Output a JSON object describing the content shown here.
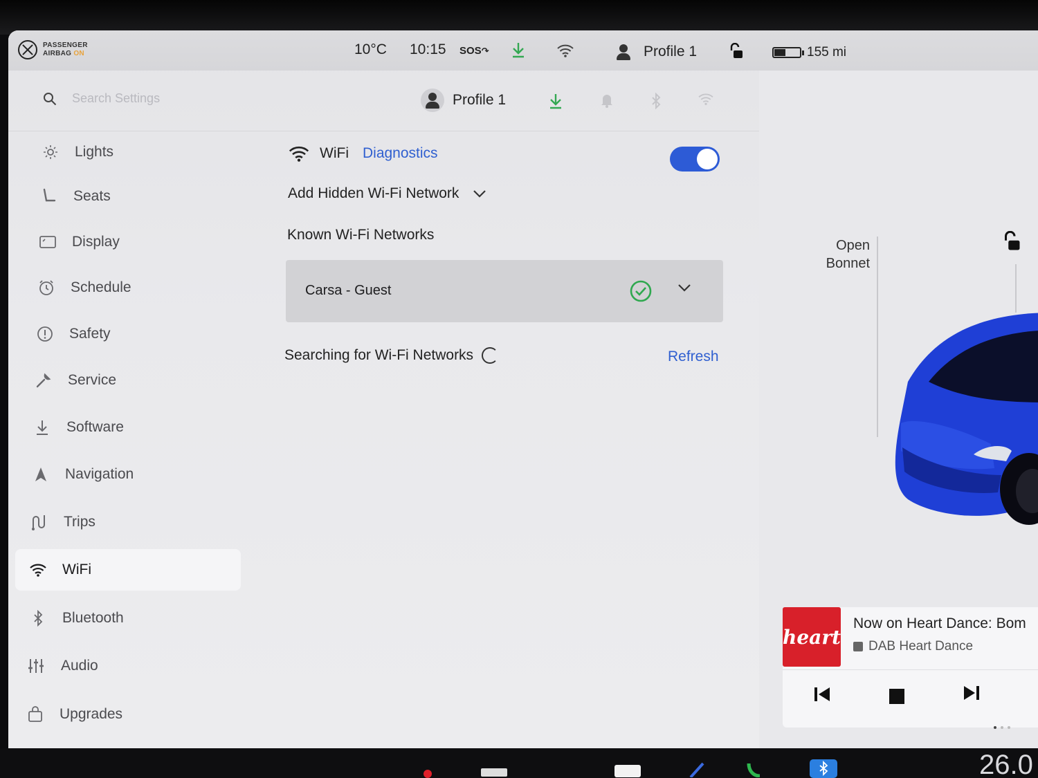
{
  "status_bar": {
    "airbag_line1": "PASSENGER",
    "airbag_line2": "AIRBAG",
    "airbag_state": "ON",
    "temperature": "10°C",
    "time": "10:15",
    "sos": "SOS",
    "profile": "Profile 1",
    "range": "155 mi",
    "battery_level": 0.45
  },
  "header": {
    "search_placeholder": "Search Settings",
    "profile": "Profile 1"
  },
  "sidebar": {
    "items": [
      {
        "label": "Lights",
        "icon": "sun-icon"
      },
      {
        "label": "Seats",
        "icon": "seat-icon"
      },
      {
        "label": "Display",
        "icon": "display-icon"
      },
      {
        "label": "Schedule",
        "icon": "alarm-clock-icon"
      },
      {
        "label": "Safety",
        "icon": "alert-circle-icon"
      },
      {
        "label": "Service",
        "icon": "wrench-icon"
      },
      {
        "label": "Software",
        "icon": "download-icon"
      },
      {
        "label": "Navigation",
        "icon": "navigation-arrow-icon"
      },
      {
        "label": "Trips",
        "icon": "trips-icon"
      },
      {
        "label": "WiFi",
        "icon": "wifi-icon"
      },
      {
        "label": "Bluetooth",
        "icon": "bluetooth-icon"
      },
      {
        "label": "Audio",
        "icon": "sliders-icon"
      },
      {
        "label": "Upgrades",
        "icon": "bag-icon"
      }
    ],
    "active": "WiFi"
  },
  "wifi": {
    "title": "WiFi",
    "diagnostics": "Diagnostics",
    "enabled": true,
    "add_hidden": "Add Hidden Wi-Fi Network",
    "known_title": "Known Wi-Fi Networks",
    "known_networks": [
      {
        "name": "Carsa - Guest",
        "connected": true
      }
    ],
    "searching": "Searching for Wi-Fi Networks",
    "refresh": "Refresh"
  },
  "vehicle": {
    "open_line1": "Open",
    "open_line2": "Bonnet"
  },
  "media": {
    "art_text": "heart",
    "now_playing": "Now on Heart Dance: Bom",
    "source": "DAB Heart Dance"
  },
  "taskbar": {
    "right_number": "26.0"
  },
  "colors": {
    "accent_blue": "#2f5fd0",
    "toggle_on": "#2d5bd6",
    "connected_green": "#2fa84f",
    "download_green": "#33a852",
    "car_blue": "#1f3fd6",
    "heart_red": "#d8202a"
  }
}
